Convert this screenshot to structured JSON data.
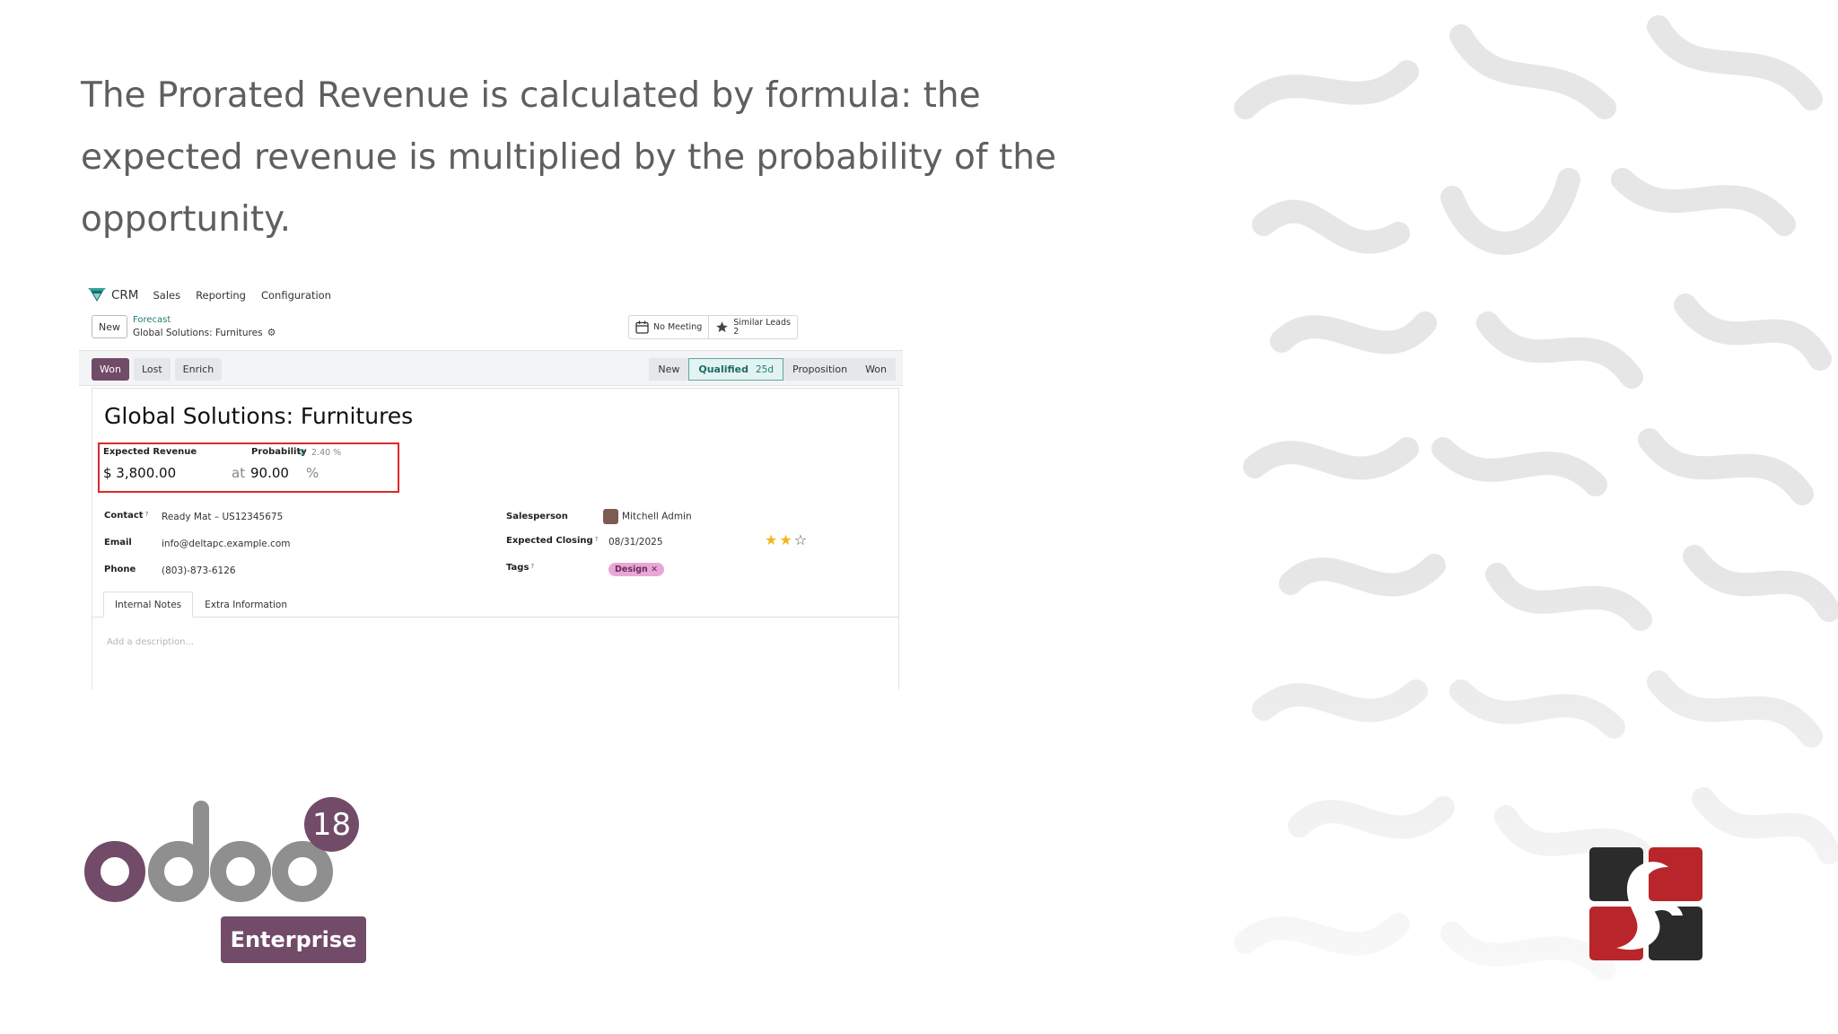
{
  "heading": "The Prorated Revenue is calculated by formula: the expected revenue is multiplied by the probability of the opportunity.",
  "crm": {
    "app_name": "CRM",
    "menu": [
      "Sales",
      "Reporting",
      "Configuration"
    ],
    "new_button": "New",
    "breadcrumb_parent": "Forecast",
    "breadcrumb_current": "Global Solutions: Furnitures",
    "smart_buttons": {
      "meeting": "No Meeting",
      "similar_label": "Similar Leads",
      "similar_count": "2"
    },
    "actions": [
      "Won",
      "Lost",
      "Enrich"
    ],
    "stages": [
      "New",
      "Qualified",
      "Proposition",
      "Won"
    ],
    "active_stage_days": "25d",
    "record_title": "Global Solutions: Furnitures",
    "expected_revenue_label": "Expected Revenue",
    "expected_revenue_value": "$ 3,800.00",
    "probability_label": "Probability",
    "auto_probability": "2.40 %",
    "at_word": "at",
    "probability_value": "90.00",
    "percent_sign": "%",
    "contact_label": "Contact",
    "contact_value": "Ready Mat – US12345675",
    "email_label": "Email",
    "email_value": "info@deltapc.example.com",
    "phone_label": "Phone",
    "phone_value": "(803)-873-6126",
    "salesperson_label": "Salesperson",
    "salesperson_value": "Mitchell Admin",
    "closing_label": "Expected Closing",
    "closing_value": "08/31/2025",
    "tags_label": "Tags",
    "tag_value": "Design",
    "priority_stars": 2,
    "priority_max": 3,
    "tabs": [
      "Internal Notes",
      "Extra Information"
    ],
    "description_placeholder": "Add a description...",
    "help_mark": "?"
  },
  "logo": {
    "version": "18",
    "edition": "Enterprise"
  },
  "colors": {
    "brand_purple": "#714b67",
    "teal": "#1d7b75",
    "highlight_red": "#d92a2a",
    "tag_pink": "#e9a7d8",
    "star_gold": "#f3b51f"
  }
}
